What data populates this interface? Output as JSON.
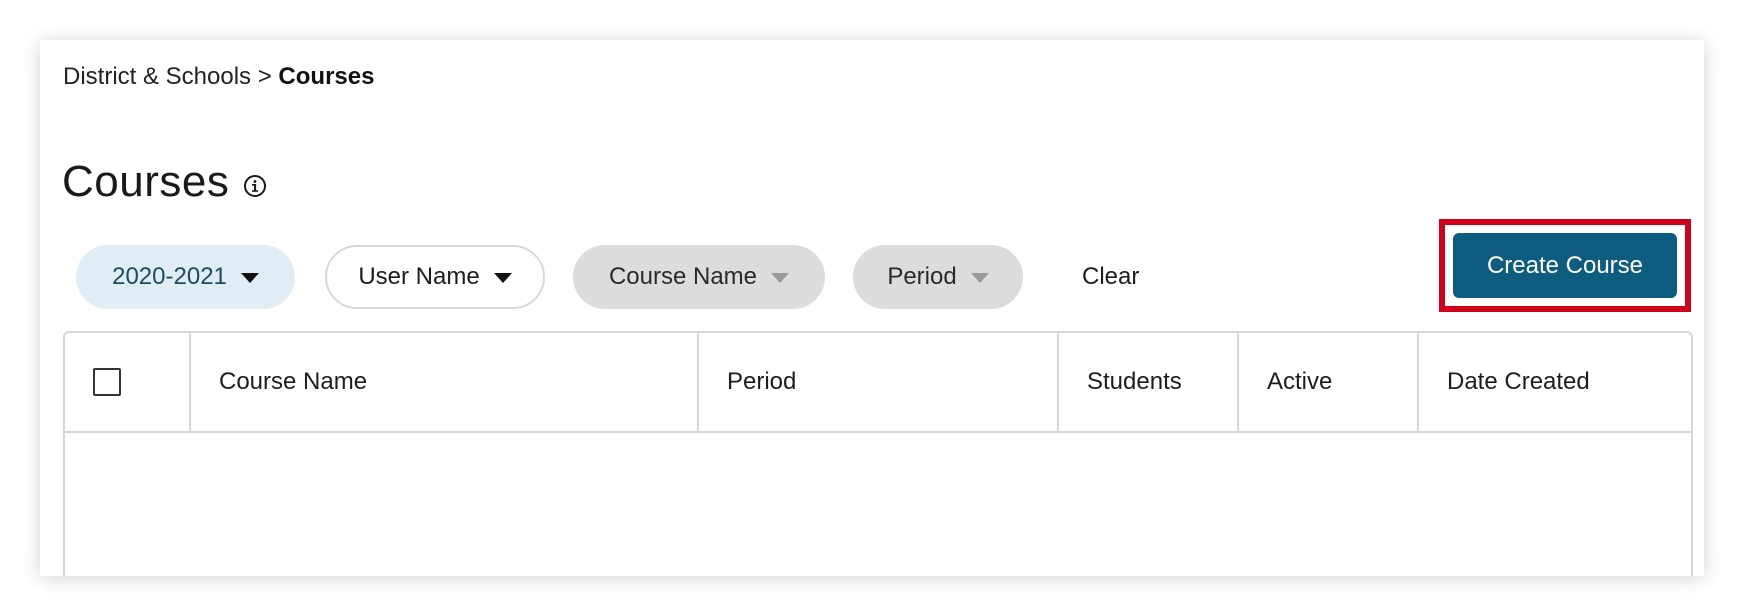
{
  "breadcrumb": {
    "parent": "District & Schools",
    "separator": ">",
    "current": "Courses"
  },
  "page": {
    "title": "Courses",
    "info_icon": "info-circle-icon"
  },
  "filters": {
    "year": "2020-2021",
    "user_name": "User Name",
    "course_name": "Course Name",
    "period": "Period",
    "clear": "Clear"
  },
  "actions": {
    "create_course": "Create Course"
  },
  "table": {
    "columns": [
      "Course Name",
      "Period",
      "Students",
      "Active",
      "Date Created"
    ],
    "rows": []
  },
  "colors": {
    "primary_button": "#0e5c80",
    "highlight_outline": "#d0021b",
    "year_chip_bg": "#e1edf4",
    "disabled_chip_bg": "#dcdcdc"
  }
}
